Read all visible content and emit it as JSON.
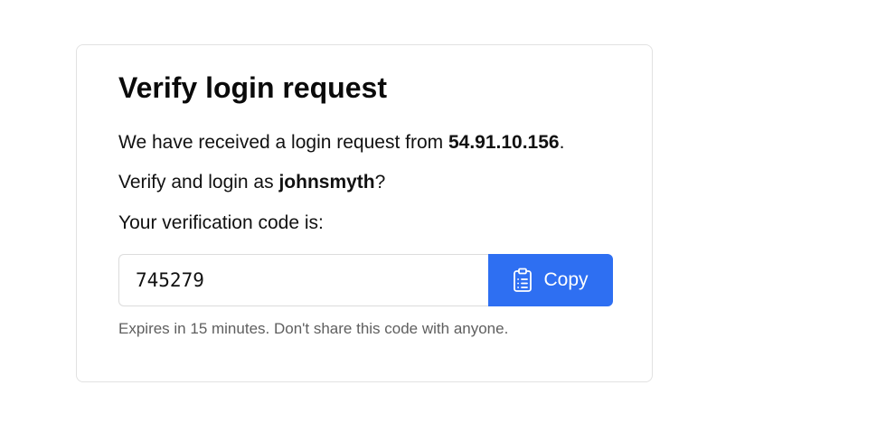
{
  "card": {
    "title": "Verify login request",
    "request_prefix": "We have received a login request from ",
    "ip_address": "54.91.10.156",
    "request_suffix": ".",
    "verify_prefix": "Verify and login as ",
    "username": "johnsmyth",
    "verify_suffix": "?",
    "code_label": "Your verification code is:",
    "code": "745279",
    "copy_label": "Copy",
    "copy_icon": "clipboard-icon",
    "hint": "Expires in 15 minutes. Don't share this code with anyone."
  },
  "colors": {
    "accent": "#2e6ff2",
    "muted_text": "#5f5f5f",
    "border": "#e2e2e2"
  }
}
